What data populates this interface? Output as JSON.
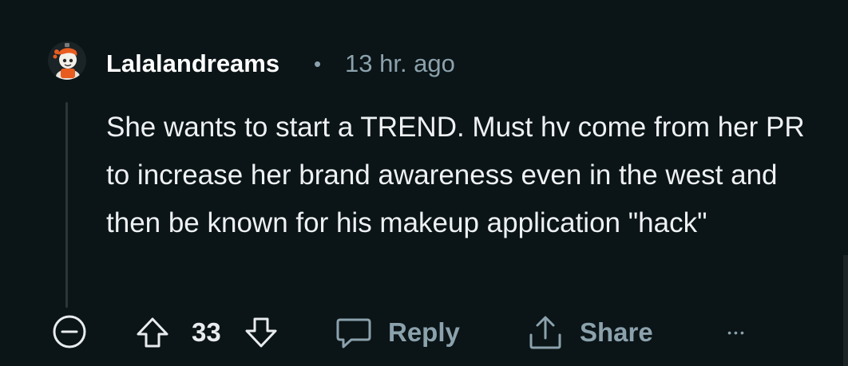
{
  "comment": {
    "author": "Lalalandreams",
    "separator": "•",
    "timestamp": "13 hr. ago",
    "body": "She wants to start a TREND. Must hv come from her PR to increase her brand awareness even in the west and then be known for his makeup application \"hack\"",
    "score": "33"
  },
  "actions": {
    "reply_label": "Reply",
    "share_label": "Share",
    "more_label": "•••"
  },
  "icons": {
    "collapse": "minus-circle-icon",
    "upvote": "arrow-up-icon",
    "downvote": "arrow-down-icon",
    "reply": "speech-bubble-icon",
    "share": "share-upload-icon",
    "more": "ellipsis-icon"
  },
  "colors": {
    "background": "#0b1416",
    "text": "#eef1f3",
    "muted": "#8ba2ad",
    "avatar_accent": "#e85d1f"
  }
}
